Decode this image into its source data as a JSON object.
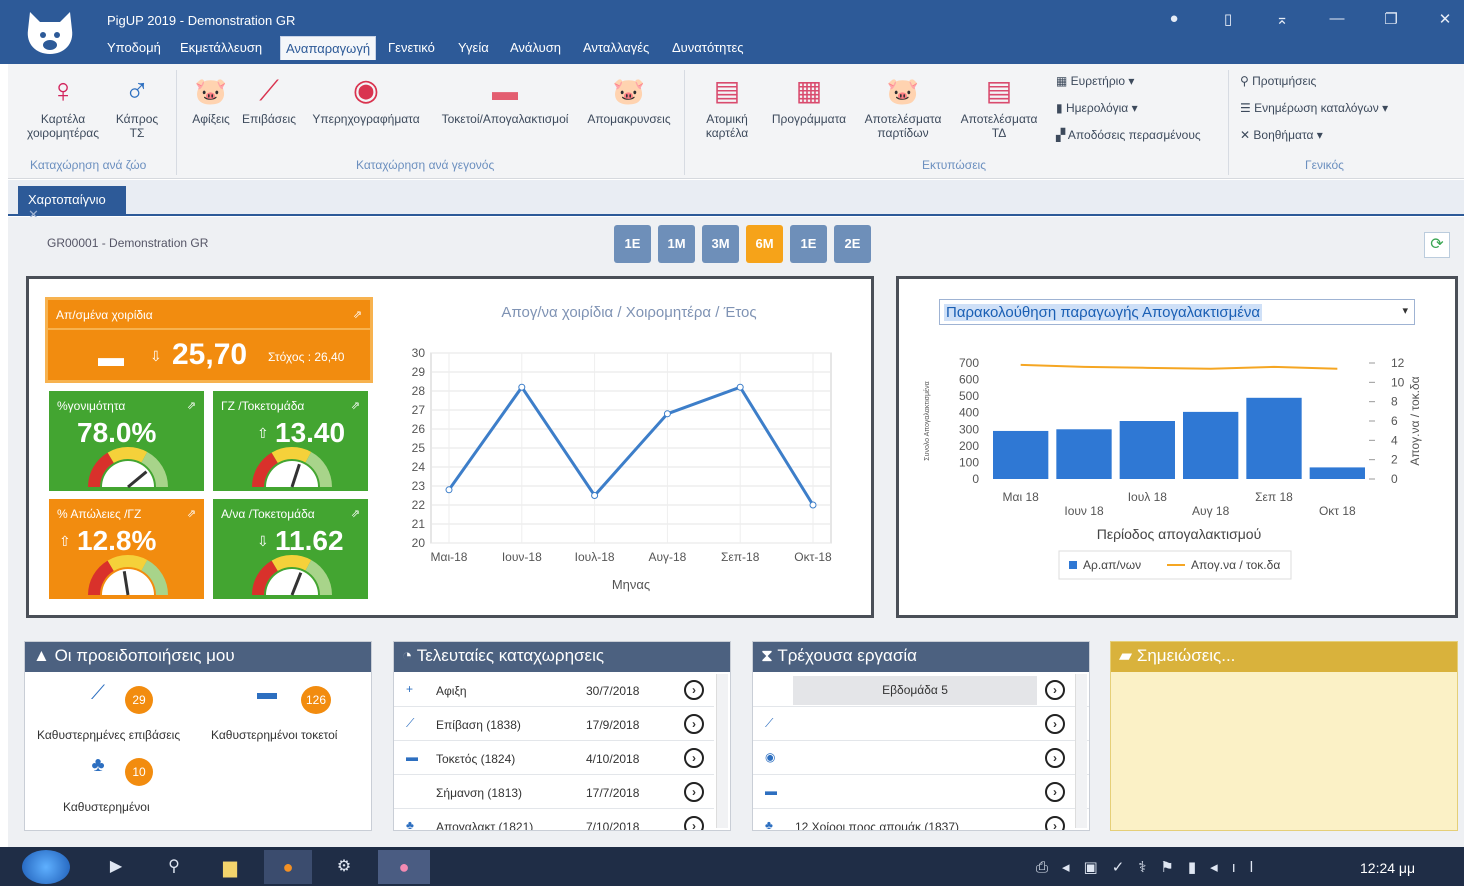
{
  "app": {
    "title": "PigUP 2019 - Demonstration GR"
  },
  "menu": [
    "Υποδομή",
    "Εκμετάλλευση",
    "Αναπαραγωγή",
    "Γενετικό",
    "Υγεία",
    "Ανάλυση",
    "Ανταλλαγές",
    "Δυνατότητες"
  ],
  "ribbon": {
    "sow_card": "Καρτέλα χοιρομητέρας",
    "boar_card": "Κάπρος ΤΣ",
    "arrivals": "Αφίξεις",
    "insemination": "Επιβάσεις",
    "ultrasound": "Υπερηχογραφήματα",
    "farrowing_weaning": "Τοκετοί/Απογαλακτισμοί",
    "culls": "Απομακρυνσεις",
    "indiv_card": "Ατομική καρτέλα",
    "programs": "Προγράμματα",
    "batch_results": "Αποτελέσματα παρτίδων",
    "results_ta": "Αποτελέσματα ΤΔ",
    "reminders": "Ευρετήριο",
    "diaries": "Ημερολόγια",
    "past_perf": "Αποδόσεις περασμένους",
    "preferences": "Προτιμήσεις",
    "list_update": "Ενημέρωση καταλόγων",
    "helpers": "Βοηθήματα",
    "group_animal": "Καταχώρηση ανά ζώο",
    "group_event": "Καταχώρηση ανά γεγονός",
    "group_print": "Εκτυπώσεις",
    "group_general": "Γενικός"
  },
  "tab": {
    "label": "Χαρτοπαίγνιο"
  },
  "farm": "GR00001 - Demonstration GR",
  "periods": [
    "1Ε",
    "1Μ",
    "3Μ",
    "6Μ",
    "1Ε",
    "2Ε"
  ],
  "active_period": "6Μ",
  "kpis": {
    "weaned": {
      "label": "Απ/σμένα χοιρίδια",
      "value": "25,70",
      "target": "Στόχος : 26,40",
      "color": "#f28c0f"
    },
    "fertility": {
      "label": "%γονιμότητα",
      "value": "78.0%",
      "color": "#43a531",
      "gauge": 0.78
    },
    "piglets_litter": {
      "label": "ΓΖ /Τοκετομάδα",
      "value": "13.40",
      "color": "#43a531",
      "gauge": 0.6
    },
    "losses": {
      "label": "% Απώλειες /ΓΖ",
      "value": "12.8%",
      "color": "#f28c0f",
      "gauge": 0.45
    },
    "weaned_litter": {
      "label": "Α/να /Τοκετομάδα",
      "value": "11.62",
      "color": "#43a531",
      "gauge": 0.62
    }
  },
  "chart_data": [
    {
      "type": "line",
      "title": "Απογ/να χοιρίδια / Χοιρομητέρα / Έτος",
      "xlabel": "Μηνας",
      "ylabel": "",
      "categories": [
        "Μαι-18",
        "Ιουν-18",
        "Ιουλ-18",
        "Αυγ-18",
        "Σεπ-18",
        "Οκτ-18"
      ],
      "series": [
        {
          "values": [
            22.8,
            28.2,
            22.5,
            26.8,
            28.2,
            22.0
          ]
        }
      ],
      "ylim": [
        20,
        30
      ],
      "yticks": [
        20,
        21,
        22,
        23,
        24,
        25,
        26,
        27,
        28,
        29,
        30
      ],
      "grid": true
    },
    {
      "type": "bar",
      "title": "Παρακολούθηση παραγωγής Απογαλακτισμένα",
      "xlabel": "Περίοδος απογαλακτισμού",
      "ylabel": "Συνολο Απογαλακτισμένα",
      "y2label": "Απογ.να / τοκ.δα",
      "categories": [
        "Μαι 18",
        "Ιουν 18",
        "Ιουλ 18",
        "Αυγ 18",
        "Σεπ 18",
        "Οκτ 18"
      ],
      "series": [
        {
          "name": "Αρ.απ/νων",
          "type": "bar",
          "values": [
            290,
            300,
            350,
            405,
            490,
            70
          ]
        },
        {
          "name": "Απογ.να / τοκ.δα",
          "type": "line",
          "axis": "right",
          "values": [
            11.8,
            11.6,
            11.5,
            11.4,
            11.6,
            11.4
          ]
        }
      ],
      "ylim": [
        0,
        700
      ],
      "y2lim": [
        0,
        12
      ],
      "yticks": [
        0,
        100,
        200,
        300,
        400,
        500,
        600,
        700
      ],
      "y2ticks": [
        0,
        2,
        4,
        6,
        8,
        10,
        12
      ],
      "legend": "bottom"
    }
  ],
  "alerts": {
    "title": "Οι προειδοποιήσεις μου",
    "items": [
      {
        "label": "Καθυστερημένες επιβάσεις",
        "count": "29"
      },
      {
        "label": "Καθυστερημένοι τοκετοί",
        "count": "126"
      },
      {
        "label": "Καθυστερημένοι",
        "count": "10"
      }
    ]
  },
  "recent": {
    "title": "Τελευταίες καταχωρησεις",
    "rows": [
      {
        "label": "Αφιξη",
        "date": "30/7/2018"
      },
      {
        "label": "Επίβαση (1838)",
        "date": "17/9/2018"
      },
      {
        "label": "Τοκετός (1824)",
        "date": "4/10/2018"
      },
      {
        "label": "Σήμανση (1813)",
        "date": "17/7/2018"
      },
      {
        "label": "Απογαλακτ (1821)",
        "date": "7/10/2018"
      }
    ]
  },
  "current": {
    "title": "Τρέχουσα εργασία",
    "week": "Εβδομάδα 5",
    "last": "12 Χοίροι προς απομάκ (1837)"
  },
  "notes": {
    "title": "Σημειώσεις..."
  },
  "taskbar": {
    "time": "12:24 μμ"
  },
  "colors": {
    "primary": "#2d5a98",
    "orange": "#f28c0f",
    "green": "#43a531",
    "bar": "#2f78d4",
    "line": "#f5a623"
  }
}
